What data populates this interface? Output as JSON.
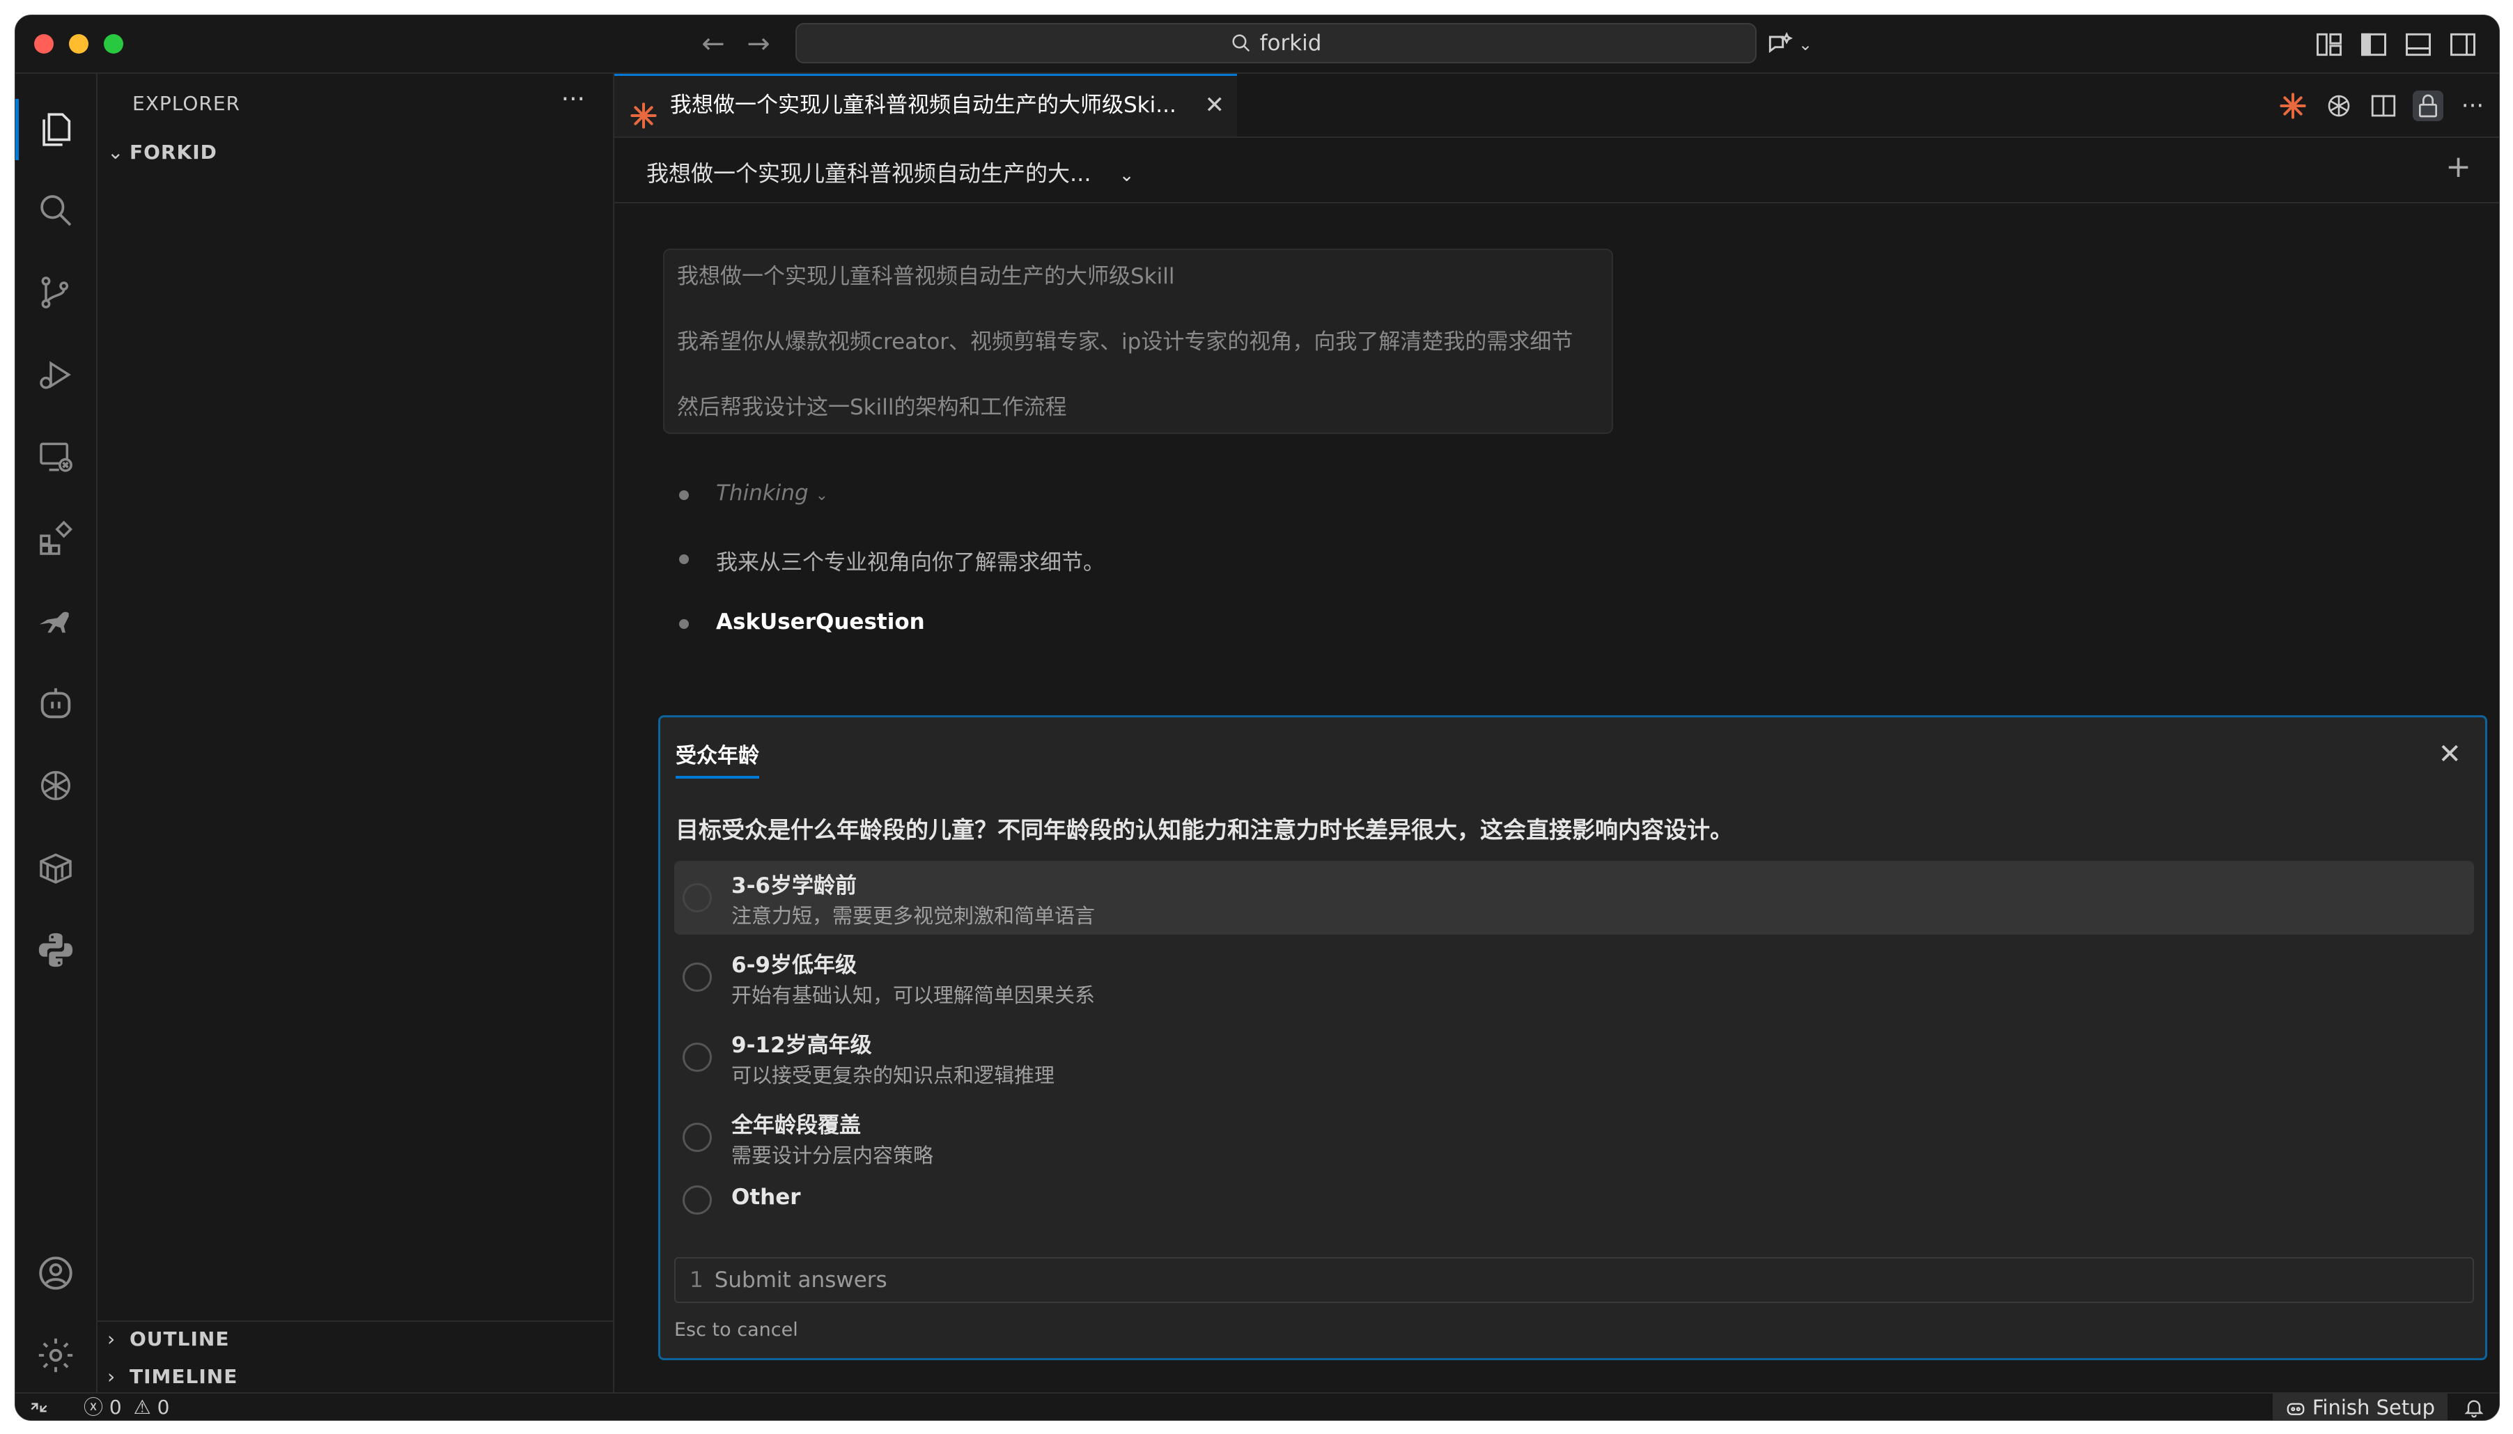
{
  "search": {
    "text": "forkid"
  },
  "sidebar": {
    "title": "EXPLORER",
    "folder": "FORKID",
    "outline": "OUTLINE",
    "timeline": "TIMELINE"
  },
  "tab": {
    "label": "我想做一个实现儿童科普视频自动生产的大师级Ski..."
  },
  "conversation": {
    "title": "我想做一个实现儿童科普视频自动生产的大...",
    "user_message": [
      "我想做一个实现儿童科普视频自动生产的大师级Skill",
      "我希望你从爆款视频creator、视频剪辑专家、ip设计专家的视角，向我了解清楚我的需求细节",
      "然后帮我设计这一Skill的架构和工作流程"
    ],
    "thinking": "Thinking",
    "reply": "我来从三个专业视角向你了解需求细节。",
    "tool": "AskUserQuestion"
  },
  "question": {
    "tab": "受众年龄",
    "text": "目标受众是什么年龄段的儿童？不同年龄段的认知能力和注意力时长差异很大，这会直接影响内容设计。",
    "options": [
      {
        "label": "3-6岁学龄前",
        "desc": "注意力短，需要更多视觉刺激和简单语言"
      },
      {
        "label": "6-9岁低年级",
        "desc": "开始有基础认知，可以理解简单因果关系"
      },
      {
        "label": "9-12岁高年级",
        "desc": "可以接受更复杂的知识点和逻辑推理"
      },
      {
        "label": "全年龄段覆盖",
        "desc": "需要设计分层内容策略"
      },
      {
        "label": "Other",
        "desc": ""
      }
    ],
    "submit_number": "1",
    "submit_label": "Submit answers",
    "cancel_hint": "Esc to cancel"
  },
  "status": {
    "errors": "0",
    "warnings": "0",
    "finish_setup": "Finish Setup"
  },
  "colors": {
    "accent": "#0078d4",
    "background": "#181818",
    "panel": "#252526",
    "claude_orange": "#e8693f"
  }
}
